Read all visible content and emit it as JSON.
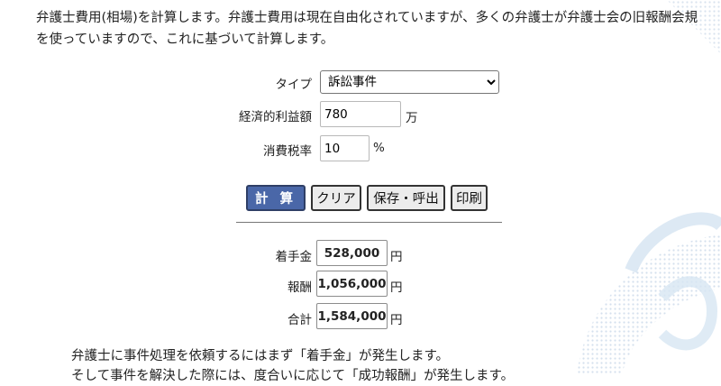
{
  "intro": {
    "line1": "弁護士費用(相場)を計算します。弁護士費用は現在自由化されていますが、多くの弁護士が弁護士会の旧報酬会規",
    "line2": "を使っていますので、これに基づいて計算します。"
  },
  "form": {
    "type": {
      "label": "タイプ",
      "value": "訴訟事件",
      "options": [
        "訴訟事件"
      ]
    },
    "benefit": {
      "label": "経済的利益額",
      "value": "780",
      "unit": "万"
    },
    "tax": {
      "label": "消費税率",
      "value": "10",
      "unit": "%"
    }
  },
  "buttons": {
    "calc": "計 算",
    "clear": "クリア",
    "save": "保存・呼出",
    "print": "印刷"
  },
  "results": {
    "retainer": {
      "label": "着手金",
      "value": "528,000",
      "unit": "円"
    },
    "reward": {
      "label": "報酬",
      "value": "1,056,000",
      "unit": "円"
    },
    "total": {
      "label": "合計",
      "value": "1,584,000",
      "unit": "円"
    }
  },
  "footer": {
    "line1": "弁護士に事件処理を依頼するにはまず「着手金」が発生します。",
    "line2": "そして事件を解決した際には、度合いに応じて「成功報酬」が発生します。"
  },
  "colors": {
    "primary_button": "#4a67a8",
    "decoration": "#dfe9f2"
  }
}
